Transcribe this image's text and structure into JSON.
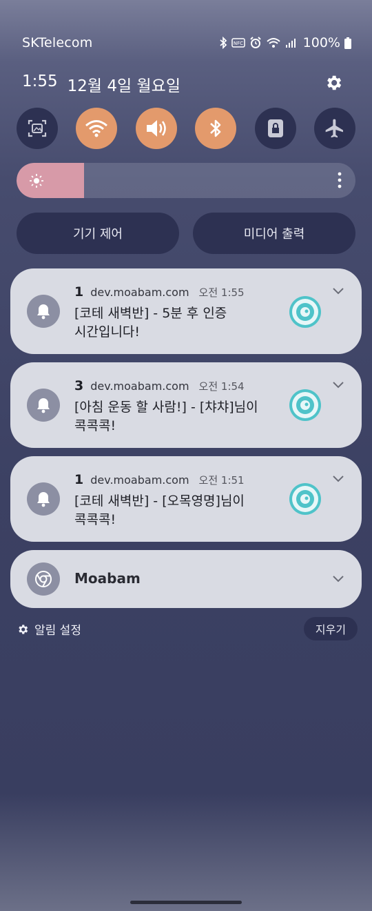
{
  "status_bar": {
    "carrier": "SKTelecom",
    "battery": "100%",
    "nfc_label": "NFC",
    "icons": [
      "bluetooth-icon",
      "nfc-icon",
      "alarm-icon",
      "wifi-icon",
      "signal-icon",
      "battery-icon"
    ]
  },
  "header": {
    "time": "1:55",
    "date": "12월 4일 월요일"
  },
  "quick_settings": {
    "tiles": [
      {
        "name": "screen-capture",
        "icon": "screenshot-icon",
        "active": false
      },
      {
        "name": "wifi",
        "icon": "wifi-icon",
        "active": true
      },
      {
        "name": "sound",
        "icon": "speaker-icon",
        "active": true
      },
      {
        "name": "bluetooth",
        "icon": "bluetooth-icon",
        "active": true
      },
      {
        "name": "rotation-lock",
        "icon": "lock-icon",
        "active": false
      },
      {
        "name": "airplane-mode",
        "icon": "airplane-icon",
        "active": false
      }
    ],
    "brightness_level": 0.2
  },
  "controls": {
    "device_control": "기기 제어",
    "media_output": "미디어 출력"
  },
  "notifications": [
    {
      "count": "1",
      "domain": "dev.moabam.com",
      "time": "오전 1:55",
      "line1": "[코테 새벽반] - 5분 후 인증",
      "line2": "시간입니다!"
    },
    {
      "count": "3",
      "domain": "dev.moabam.com",
      "time": "오전 1:54",
      "line1": "[아침 운동 할 사람!] - [챠챠]님이",
      "line2": "콕콕콕!"
    },
    {
      "count": "1",
      "domain": "dev.moabam.com",
      "time": "오전 1:51",
      "line1": "[코테 새벽반] - [오목영명]님이",
      "line2": "콕콕콕!"
    }
  ],
  "group": {
    "app_name": "Moabam",
    "icon": "chrome-icon"
  },
  "footer": {
    "settings_label": "알림 설정",
    "clear_label": "지우기"
  },
  "colors": {
    "tile_active": "#e39a6c",
    "tile_inactive": "#2d3152",
    "card_background": "#d9dbe3",
    "brightness_fill": "#d79aa8",
    "avatar_accent": "#4fc3c9"
  }
}
